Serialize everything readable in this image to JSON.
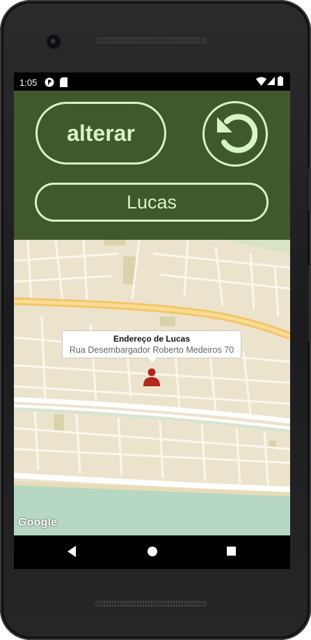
{
  "status": {
    "time": "1:05"
  },
  "header": {
    "alterar_label": "alterar",
    "name_value": "Lucas"
  },
  "map": {
    "info_title": "Endereço de Lucas",
    "info_address": "Rua Desembargador Roberto Medeiros 70",
    "logo_text": "Google"
  },
  "colors": {
    "header_bg": "#41582c",
    "header_accent": "#d5f5c6",
    "marker": "#b3261e"
  }
}
